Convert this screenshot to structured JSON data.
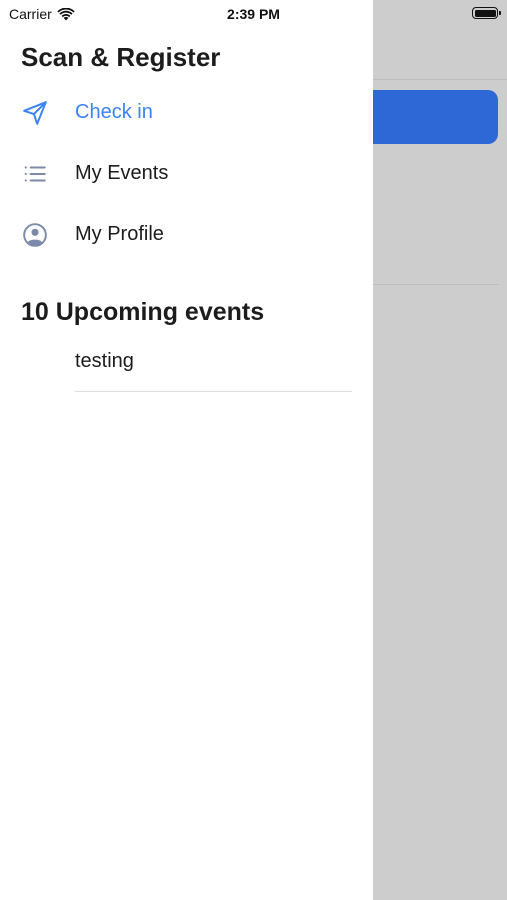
{
  "status_bar": {
    "carrier": "Carrier",
    "time": "2:39 PM"
  },
  "drawer": {
    "title": "Scan & Register",
    "menu": [
      {
        "label": "Check in",
        "icon": "paper-plane-icon",
        "active": true
      },
      {
        "label": "My Events",
        "icon": "list-icon",
        "active": false
      },
      {
        "label": "My Profile",
        "icon": "user-circle-icon",
        "active": false
      }
    ],
    "events_section": {
      "title": "10 Upcoming events",
      "items": [
        "testing"
      ]
    }
  },
  "colors": {
    "accent": "#3a82f7",
    "icon_gray": "#7a8aa8",
    "background_button": "#2d68d6",
    "overlay": "#cdcdcd"
  }
}
